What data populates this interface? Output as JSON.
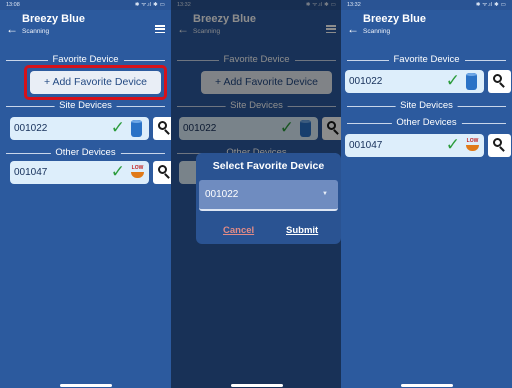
{
  "screens": [
    {
      "status_time": "13:08",
      "status_icons": "✱ ᯤ.ıl ✱ ▭",
      "app_title": "Breezy Blue",
      "app_subtitle": "Scanning",
      "favorite_section": "Favorite Device",
      "add_favorite_label": "+ Add Favorite Device",
      "site_section": "Site Devices",
      "site_device_id": "001022",
      "other_section": "Other Devices",
      "other_device_id": "001047",
      "low_badge": "LOW"
    },
    {
      "status_time": "13:32",
      "status_icons": "✱ ᯤ.ıl ✱ ▭",
      "app_title": "Breezy Blue",
      "app_subtitle": "Scanning",
      "favorite_section": "Favorite Device",
      "add_favorite_label": "+ Add Favorite Device",
      "site_section": "Site Devices",
      "site_device_id": "001022",
      "other_section": "Other Devices",
      "dialog": {
        "title": "Select Favorite Device",
        "selected_value": "001022",
        "cancel_label": "Cancel",
        "submit_label": "Submit"
      }
    },
    {
      "status_time": "13:32",
      "status_icons": "✱ ᯤ.ıl ✱ ▭",
      "app_title": "Breezy Blue",
      "app_subtitle": "Scanning",
      "favorite_section": "Favorite Device",
      "favorite_device_id": "001022",
      "site_section": "Site Devices",
      "other_section": "Other Devices",
      "other_device_id": "001047",
      "low_badge": "LOW"
    }
  ],
  "colors": {
    "app_background": "#2c5a9e",
    "card_background": "#ddeefb",
    "highlight_border": "#d6111a",
    "check_green": "#2c9c3c",
    "cancel_text": "#e28b86"
  }
}
